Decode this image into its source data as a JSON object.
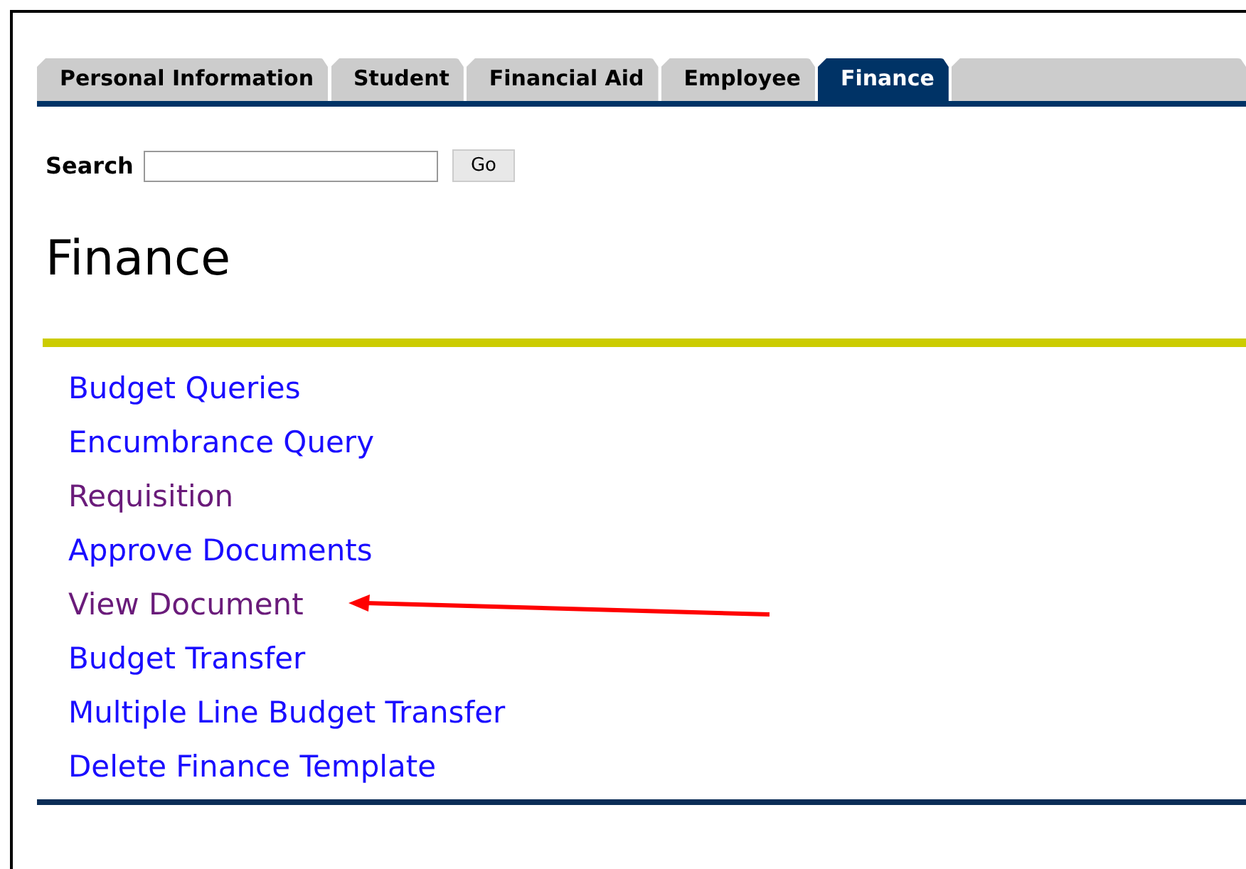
{
  "tabs": [
    {
      "label": "Personal Information",
      "selected": false
    },
    {
      "label": "Student",
      "selected": false
    },
    {
      "label": "Financial Aid",
      "selected": false
    },
    {
      "label": "Employee",
      "selected": false
    },
    {
      "label": "Finance",
      "selected": true
    }
  ],
  "search": {
    "label": "Search",
    "button": "Go"
  },
  "heading": "Finance",
  "links": [
    {
      "label": "Budget Queries",
      "visited": false,
      "pointed_at": false
    },
    {
      "label": "Encumbrance Query",
      "visited": false,
      "pointed_at": false
    },
    {
      "label": "Requisition",
      "visited": true,
      "pointed_at": false
    },
    {
      "label": "Approve Documents",
      "visited": false,
      "pointed_at": false
    },
    {
      "label": "View Document",
      "visited": true,
      "pointed_at": true
    },
    {
      "label": "Budget Transfer",
      "visited": false,
      "pointed_at": false
    },
    {
      "label": "Multiple Line Budget Transfer",
      "visited": false,
      "pointed_at": false
    },
    {
      "label": "Delete Finance Template",
      "visited": false,
      "pointed_at": false
    }
  ]
}
